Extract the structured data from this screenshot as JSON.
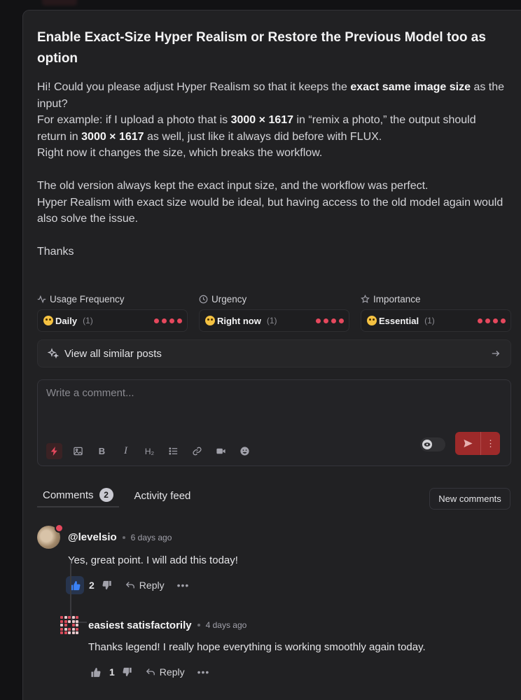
{
  "post": {
    "title": "Enable Exact-Size Hyper Realism or Restore the Previous Model too as option",
    "body": [
      {
        "parts": [
          {
            "t": "Hi! Could you please adjust Hyper Realism so that it keeps the "
          },
          {
            "t": "exact same image size",
            "b": true
          },
          {
            "t": " as the input?"
          }
        ]
      },
      {
        "parts": [
          {
            "t": "For example: if I upload a photo that is "
          },
          {
            "t": "3000 × 1617",
            "b": true
          },
          {
            "t": " in “remix a photo,” the output should return in "
          },
          {
            "t": "3000 × 1617",
            "b": true
          },
          {
            "t": " as well,  just like it always did before with FLUX."
          }
        ]
      },
      {
        "parts": [
          {
            "t": "Right now it changes the size, which breaks the workflow."
          }
        ]
      },
      {
        "parts": []
      },
      {
        "parts": [
          {
            "t": "The old version always kept the exact input size, and the workflow was perfect."
          }
        ]
      },
      {
        "parts": [
          {
            "t": "Hyper Realism with exact size would be ideal, but having access to the old model again would also solve the issue."
          }
        ]
      },
      {
        "parts": []
      },
      {
        "parts": [
          {
            "t": "Thanks"
          }
        ]
      }
    ]
  },
  "metrics": [
    {
      "label": "Usage Frequency",
      "icon": "activity-icon",
      "value": "Daily",
      "count": "(1)",
      "level": 4
    },
    {
      "label": "Urgency",
      "icon": "clock-icon",
      "value": "Right now",
      "count": "(1)",
      "level": 4
    },
    {
      "label": "Importance",
      "icon": "star-icon",
      "value": "Essential",
      "count": "(1)",
      "level": 4
    }
  ],
  "similar": {
    "label": "View all similar posts"
  },
  "composer": {
    "placeholder": "Write a comment..."
  },
  "tabs": {
    "comments_label": "Comments",
    "comments_count": "2",
    "activity_label": "Activity feed",
    "new_comments": "New comments"
  },
  "comments": [
    {
      "author": "@levelsio",
      "time": "6 days ago",
      "text": "Yes, great point. I will add this today!",
      "likes": "2",
      "reply": "Reply"
    },
    {
      "author": "easiest satisfactorily",
      "time": "4 days ago",
      "text": "Thanks legend! I really hope everything is working smoothly again today.",
      "likes": "1",
      "reply": "Reply"
    }
  ],
  "colors": {
    "accent": "#e5485d",
    "send": "#9d2a2a",
    "panel": "#212123",
    "like_active": "#3b82f6"
  }
}
